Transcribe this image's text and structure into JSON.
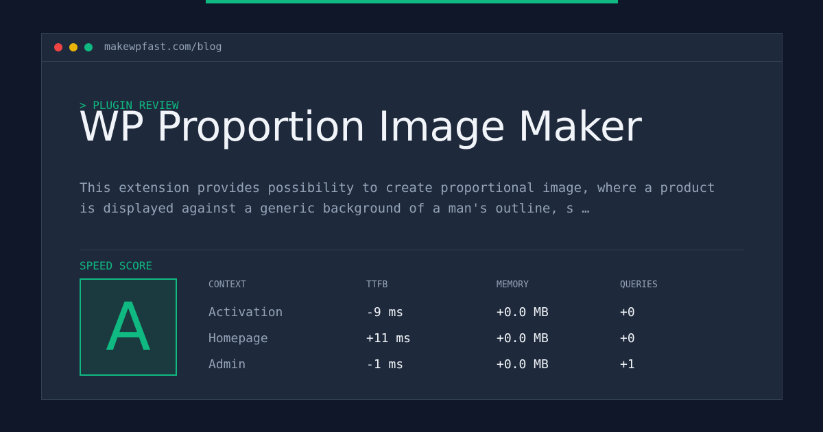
{
  "colors": {
    "accent": "#10b981",
    "background": "#0f1729",
    "card": "#1e293b",
    "dot_red": "#ef4444",
    "dot_yellow": "#eab308",
    "dot_green": "#10b981"
  },
  "window": {
    "url": "makewpfast.com/blog"
  },
  "article": {
    "kicker": "> PLUGIN REVIEW",
    "title": "WP Proportion Image Maker",
    "description": "This extension provides possibility to create proportional image, where a product is displayed against a generic background of a man's outline, s …"
  },
  "score": {
    "label": "SPEED SCORE",
    "grade": "A"
  },
  "table": {
    "headers": [
      "CONTEXT",
      "TTFB",
      "MEMORY",
      "QUERIES"
    ],
    "rows": [
      {
        "context": "Activation",
        "ttfb": "-9 ms",
        "memory": "+0.0 MB",
        "queries": "+0"
      },
      {
        "context": "Homepage",
        "ttfb": "+11 ms",
        "memory": "+0.0 MB",
        "queries": "+0"
      },
      {
        "context": "Admin",
        "ttfb": "-1 ms",
        "memory": "+0.0 MB",
        "queries": "+1"
      }
    ]
  }
}
